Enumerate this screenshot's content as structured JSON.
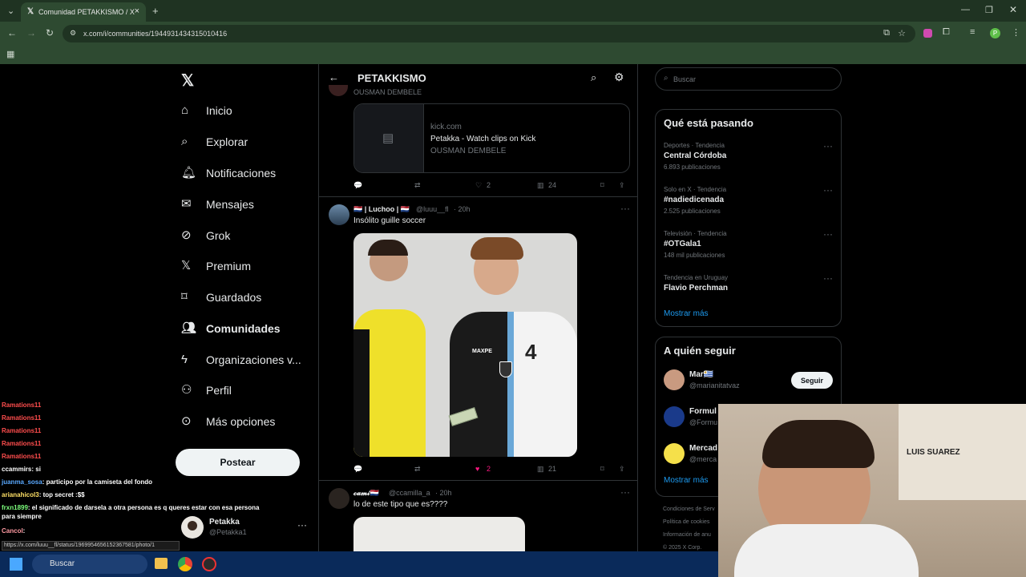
{
  "browser": {
    "tab_title": "Comunidad PETAKKISMO / X",
    "url": "x.com/i/communities/1944931434315010416",
    "status_url": "https://x.com/luuu__fl/status/1969954656152367581/photo/1"
  },
  "sidebar": {
    "items": [
      {
        "label": "Inicio",
        "icon": "home-icon"
      },
      {
        "label": "Explorar",
        "icon": "search-icon"
      },
      {
        "label": "Notificaciones",
        "icon": "bell-icon"
      },
      {
        "label": "Mensajes",
        "icon": "mail-icon"
      },
      {
        "label": "Grok",
        "icon": "grok-icon"
      },
      {
        "label": "Premium",
        "icon": "x-logo-icon"
      },
      {
        "label": "Guardados",
        "icon": "bookmark-icon"
      },
      {
        "label": "Comunidades",
        "icon": "people-icon"
      },
      {
        "label": "Organizaciones v...",
        "icon": "lightning-icon"
      },
      {
        "label": "Perfil",
        "icon": "person-icon"
      },
      {
        "label": "Más opciones",
        "icon": "more-circle-icon"
      }
    ],
    "post_button": "Postear",
    "account": {
      "name": "Petakka",
      "handle": "@Petakka1"
    }
  },
  "header": {
    "title": "PETAKKISMO"
  },
  "feed": {
    "post1": {
      "partial_text": "OUSMAN DEMBELE",
      "card": {
        "domain": "kick.com",
        "title": "Petakka - Watch clips on Kick",
        "subtitle": "OUSMAN DEMBELE"
      },
      "likes": "2",
      "views": "24"
    },
    "post2": {
      "name": "| Luchoo |",
      "handle": "@luuu__fl",
      "time": "· 20h",
      "text": "Insólito guille soccer",
      "likes": "2",
      "views": "21",
      "jersey_number": "4",
      "jersey_brand": "MAXPE"
    },
    "post3": {
      "name": "𝓬𝓪𝓶𝓲",
      "handle": "@ccamilla_a",
      "time": "· 20h",
      "text": "lo de este tipo que es????"
    }
  },
  "right": {
    "search_placeholder": "Buscar",
    "trends_title": "Qué está pasando",
    "trends": [
      {
        "category": "Deportes · Tendencia",
        "name": "Central Córdoba",
        "count": "6.893 publicaciones"
      },
      {
        "category": "Solo en X · Tendencia",
        "name": "#nadiedicenada",
        "count": "2.525 publicaciones"
      },
      {
        "category": "Televisión · Tendencia",
        "name": "#OTGala1",
        "count": "148 mil publicaciones"
      },
      {
        "category": "Tendencia en Uruguay",
        "name": "Flavio Perchman",
        "count": ""
      }
    ],
    "show_more": "Mostrar más",
    "follow_title": "A quién seguir",
    "follow": [
      {
        "name": "Mar🇺🇾",
        "handle": "@marianitatvaz"
      },
      {
        "name": "Formul",
        "handle": "@Formu"
      },
      {
        "name": "Mercad",
        "handle": "@merca"
      }
    ],
    "follow_button": "Seguir",
    "follow_more": "Mostrar más",
    "footer": [
      "Condiciones de Serv",
      "Política de cookies",
      "Información de anu",
      "© 2025 X Corp."
    ]
  },
  "chat": [
    {
      "user": "Ramations11",
      "msg": "",
      "color": "#ff4d4d"
    },
    {
      "user": "Ramations11",
      "msg": "",
      "color": "#ff4d4d"
    },
    {
      "user": "Ramations11",
      "msg": "",
      "color": "#ff4d4d"
    },
    {
      "user": "Ramations11",
      "msg": "",
      "color": "#ff4d4d"
    },
    {
      "user": "Ramations11",
      "msg": "",
      "color": "#ff4d4d"
    },
    {
      "user": "ccammirs",
      "msg": ": si",
      "color": "#ffffff"
    },
    {
      "user": "juanma_sosa",
      "msg": ": participo por la camiseta del fondo",
      "color": "#5aa9ff"
    },
    {
      "user": "arianahicol3",
      "msg": ": top secret :$$",
      "color": "#ffe066"
    },
    {
      "user": "frxn1899",
      "msg": ": el significado de darsela a otra persona es q queres estar con esa persona para siempre",
      "color": "#7dff7d"
    },
    {
      "user": "Cancol",
      "msg": ":",
      "color": "#ff9aa2"
    },
    {
      "user": "Cancol",
      "msg": ":",
      "color": "#ff9aa2"
    },
    {
      "user": "Cancol",
      "msg": ":",
      "color": "#ff9aa2"
    },
    {
      "user": "Cancol",
      "msg": ":",
      "color": "#ff9aa2"
    }
  ],
  "taskbar": {
    "search": "Buscar"
  },
  "webcam": {
    "poster_text": "LUIS SUAREZ"
  }
}
